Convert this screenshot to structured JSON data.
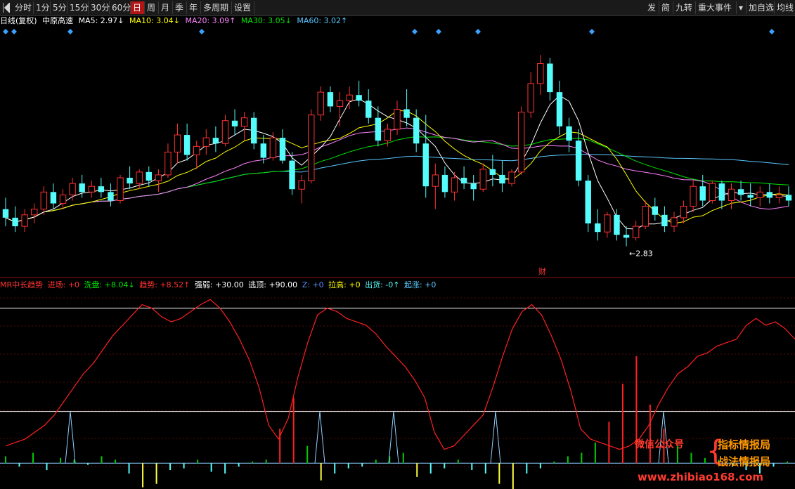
{
  "toolbar": {
    "left_items": [
      "分时",
      "1分",
      "5分",
      "15分",
      "30分",
      "60分",
      "日",
      "周",
      "月",
      "季",
      "年",
      "多周期",
      "设置"
    ],
    "active": "日",
    "right_items": [
      "发",
      "简",
      "九转",
      "重大事件",
      "▾",
      "加自选",
      "均线"
    ]
  },
  "info": {
    "label": "日线(复权)",
    "stock": "中原高速",
    "ma5": "MA5: 2.97↓",
    "ma10": "MA10: 3.04↓",
    "ma20": "MA20: 3.09↑",
    "ma30": "MA30: 3.05↓",
    "ma60": "MA60: 3.02↑"
  },
  "indicator": {
    "name": "MR中长趋势",
    "jinchang": "进场: +0",
    "xipan": "洗盘: +8.04↓",
    "qushi": "趋势: +8.52↑",
    "qiangruo": "强弱: +30.00",
    "taoding": "逃顶: +90.00",
    "z": "Z: +0",
    "lagao": "拉高: +0",
    "chuhuo": "出货: -0↑",
    "qizhang": "起涨: +0"
  },
  "annotations": {
    "low_label": "←2.83",
    "cai_label": "财"
  },
  "watermark": {
    "wechat": "微信公众号",
    "brand1": "指标情报局",
    "brand2": "战法情报局",
    "url": "www.zhibiao168.com"
  },
  "colors": {
    "up": "#ff3232",
    "down": "#54fcfc",
    "ma5": "#ffffff",
    "ma10": "#ffff00",
    "ma20": "#ff80ff",
    "ma30": "#00e600",
    "ma60": "#5ac8ff",
    "trend": "#ff2020",
    "bar_green": "#00cc00",
    "bar_cyan": "#54fcfc",
    "bar_yellow": "#ffff40",
    "bar_red": "#ff2020",
    "peak": "#8fd0ff"
  },
  "chart_data": [
    {
      "type": "candlestick",
      "title": "中原高速 日线(复权)",
      "ylim": [
        2.75,
        3.55
      ],
      "low_marker": 2.83,
      "candles": [
        [
          2.96,
          3.0,
          2.9,
          2.93
        ],
        [
          2.93,
          2.97,
          2.88,
          2.9
        ],
        [
          2.9,
          2.96,
          2.88,
          2.94
        ],
        [
          2.94,
          2.98,
          2.91,
          2.96
        ],
        [
          2.96,
          3.04,
          2.94,
          3.02
        ],
        [
          3.02,
          3.05,
          2.96,
          2.98
        ],
        [
          2.98,
          3.03,
          2.96,
          3.01
        ],
        [
          3.01,
          3.07,
          2.99,
          3.05
        ],
        [
          3.05,
          3.08,
          3.0,
          3.02
        ],
        [
          3.02,
          3.06,
          3.0,
          3.04
        ],
        [
          3.04,
          3.07,
          3.0,
          3.02
        ],
        [
          3.02,
          3.05,
          2.97,
          2.99
        ],
        [
          2.99,
          3.08,
          2.98,
          3.07
        ],
        [
          3.07,
          3.11,
          3.03,
          3.05
        ],
        [
          3.05,
          3.1,
          3.03,
          3.09
        ],
        [
          3.09,
          3.11,
          3.04,
          3.06
        ],
        [
          3.06,
          3.1,
          3.02,
          3.08
        ],
        [
          3.08,
          3.19,
          3.07,
          3.16
        ],
        [
          3.16,
          3.26,
          3.12,
          3.22
        ],
        [
          3.22,
          3.26,
          3.13,
          3.15
        ],
        [
          3.15,
          3.2,
          3.1,
          3.18
        ],
        [
          3.18,
          3.24,
          3.15,
          3.21
        ],
        [
          3.21,
          3.25,
          3.16,
          3.19
        ],
        [
          3.19,
          3.29,
          3.18,
          3.27
        ],
        [
          3.27,
          3.31,
          3.22,
          3.25
        ],
        [
          3.25,
          3.3,
          3.2,
          3.28
        ],
        [
          3.28,
          3.3,
          3.17,
          3.19
        ],
        [
          3.19,
          3.22,
          3.12,
          3.14
        ],
        [
          3.14,
          3.23,
          3.13,
          3.21
        ],
        [
          3.21,
          3.24,
          3.12,
          3.13
        ],
        [
          3.13,
          3.16,
          3.01,
          3.03
        ],
        [
          3.03,
          3.08,
          2.98,
          3.06
        ],
        [
          3.06,
          3.31,
          3.05,
          3.29
        ],
        [
          3.29,
          3.39,
          3.27,
          3.37
        ],
        [
          3.37,
          3.39,
          3.3,
          3.32
        ],
        [
          3.32,
          3.37,
          3.25,
          3.34
        ],
        [
          3.34,
          3.39,
          3.31,
          3.36
        ],
        [
          3.36,
          3.41,
          3.32,
          3.34
        ],
        [
          3.34,
          3.38,
          3.26,
          3.28
        ],
        [
          3.28,
          3.32,
          3.18,
          3.2
        ],
        [
          3.2,
          3.26,
          3.18,
          3.24
        ],
        [
          3.24,
          3.34,
          3.22,
          3.31
        ],
        [
          3.31,
          3.38,
          3.25,
          3.28
        ],
        [
          3.28,
          3.31,
          3.16,
          3.19
        ],
        [
          3.19,
          3.29,
          3.0,
          3.04
        ],
        [
          3.04,
          3.12,
          2.96,
          3.08
        ],
        [
          3.08,
          3.11,
          3.0,
          3.02
        ],
        [
          3.02,
          3.09,
          2.99,
          3.07
        ],
        [
          3.07,
          3.11,
          3.03,
          3.05
        ],
        [
          3.05,
          3.08,
          2.99,
          3.03
        ],
        [
          3.03,
          3.12,
          3.02,
          3.1
        ],
        [
          3.1,
          3.15,
          3.04,
          3.08
        ],
        [
          3.08,
          3.13,
          3.02,
          3.05
        ],
        [
          3.05,
          3.1,
          3.04,
          3.09
        ],
        [
          3.09,
          3.32,
          3.08,
          3.3
        ],
        [
          3.3,
          3.44,
          3.28,
          3.4
        ],
        [
          3.4,
          3.5,
          3.36,
          3.47
        ],
        [
          3.47,
          3.49,
          3.34,
          3.37
        ],
        [
          3.37,
          3.41,
          3.22,
          3.25
        ],
        [
          3.25,
          3.28,
          3.16,
          3.2
        ],
        [
          3.2,
          3.24,
          3.04,
          3.06
        ],
        [
          3.06,
          3.08,
          2.88,
          2.91
        ],
        [
          2.91,
          2.96,
          2.85,
          2.88
        ],
        [
          2.88,
          2.95,
          2.86,
          2.94
        ],
        [
          2.94,
          2.96,
          2.85,
          2.87
        ],
        [
          2.87,
          2.9,
          2.83,
          2.86
        ],
        [
          2.86,
          2.92,
          2.85,
          2.9
        ],
        [
          2.9,
          2.99,
          2.89,
          2.97
        ],
        [
          2.97,
          3.0,
          2.92,
          2.94
        ],
        [
          2.94,
          2.97,
          2.88,
          2.9
        ],
        [
          2.9,
          2.95,
          2.88,
          2.93
        ],
        [
          2.93,
          2.99,
          2.91,
          2.97
        ],
        [
          2.97,
          3.06,
          2.95,
          3.04
        ],
        [
          3.04,
          3.08,
          2.97,
          2.99
        ],
        [
          2.99,
          3.06,
          2.98,
          3.05
        ],
        [
          3.05,
          3.06,
          2.96,
          2.99
        ],
        [
          2.99,
          3.05,
          2.96,
          3.03
        ],
        [
          3.03,
          3.06,
          2.99,
          3.01
        ],
        [
          3.01,
          3.05,
          2.97,
          3.0
        ],
        [
          3.0,
          3.04,
          2.97,
          3.02
        ],
        [
          3.02,
          3.05,
          2.98,
          3.0
        ],
        [
          3.0,
          3.04,
          2.98,
          3.01
        ],
        [
          3.01,
          3.04,
          2.97,
          2.99
        ]
      ]
    },
    {
      "type": "line",
      "title": "MR中长趋势",
      "ylim": [
        -15,
        100
      ],
      "reference_lines": [
        30,
        90
      ],
      "trend": [
        10,
        12,
        14,
        18,
        22,
        28,
        36,
        44,
        52,
        58,
        66,
        74,
        80,
        86,
        92,
        90,
        85,
        82,
        84,
        88,
        92,
        95,
        90,
        82,
        72,
        60,
        44,
        22,
        14,
        26,
        50,
        70,
        86,
        90,
        88,
        84,
        82,
        80,
        75,
        68,
        62,
        56,
        48,
        38,
        18,
        8,
        10,
        16,
        22,
        28,
        44,
        62,
        78,
        88,
        92,
        86,
        74,
        60,
        42,
        20,
        14,
        12,
        10,
        8,
        10,
        14,
        22,
        34,
        44,
        52,
        56,
        62,
        64,
        68,
        70,
        72,
        80,
        84,
        80,
        82,
        78,
        72
      ],
      "bars": [
        4,
        -2,
        6,
        -4,
        3,
        2,
        -1,
        4,
        2,
        -6,
        -14,
        -12,
        -4,
        -3,
        2,
        -5,
        -6,
        -2,
        1,
        2,
        20,
        38,
        10,
        -10,
        -6,
        -3,
        -2,
        2,
        4,
        6,
        -8,
        -6,
        -3,
        2,
        -4,
        -6,
        -12,
        -20,
        -6,
        -3,
        1,
        4,
        6,
        12,
        24,
        46,
        62,
        34,
        20,
        10,
        6,
        3,
        2,
        -2,
        -4,
        -6,
        -2,
        1
      ]
    }
  ]
}
